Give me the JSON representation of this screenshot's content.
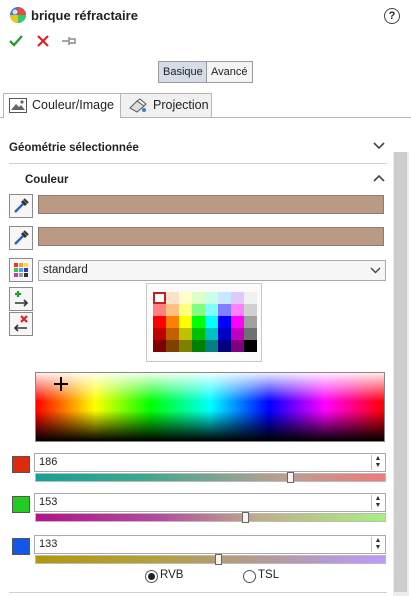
{
  "header": {
    "title": "brique réfractaire",
    "help_glyph": "?",
    "title_icon": "appearance-ball-icon"
  },
  "actions": {
    "ok_glyph": "✔",
    "cancel_glyph": "✕",
    "pin_glyph": "⊸"
  },
  "mode": {
    "options": [
      "Basique",
      "Avancé"
    ],
    "selected": "Basique"
  },
  "tabs": [
    {
      "label": "Couleur/Image",
      "icon": "image-icon",
      "active": true
    },
    {
      "label": "Projection",
      "icon": "projection-icon",
      "active": false
    }
  ],
  "geometry": {
    "title": "Géométrie sélectionnée",
    "expanded": false
  },
  "color": {
    "title": "Couleur",
    "expanded": true,
    "swatch_color": "#ba9985",
    "swatch_color_2": "#b99985",
    "palette_select": "standard",
    "rgb": {
      "r": "186",
      "g": "153",
      "b": "133"
    },
    "slider_fractions": {
      "r": 0.729,
      "g": 0.6,
      "b": 0.522
    },
    "mode_options": [
      "RVB",
      "TSL"
    ],
    "mode_selected": "RVB"
  },
  "colors": {
    "channel_r": "#e02a10",
    "channel_g": "#22cc22",
    "channel_b": "#1456e8"
  }
}
